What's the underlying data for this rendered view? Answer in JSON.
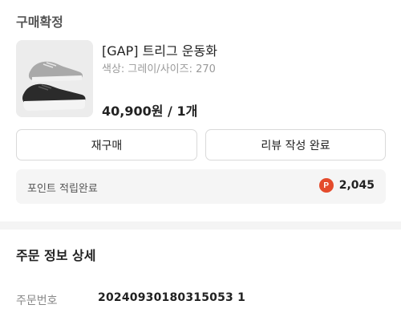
{
  "order_status": "구매확정",
  "product": {
    "name": "[GAP] 트리그 운동화",
    "option": "색상: 그레이/사이즈: 270",
    "price_qty": "40,900원 / 1개"
  },
  "buttons": {
    "rebuy": "재구매",
    "review": "리뷰 작성 완료"
  },
  "points": {
    "label": "포인트 적립완료",
    "icon_letter": "P",
    "value": "2,045",
    "icon_color": "#e44b2c"
  },
  "order_detail": {
    "title": "주문 정보 상세",
    "number_label": "주문번호",
    "number_value": "20240930180315053 1"
  }
}
